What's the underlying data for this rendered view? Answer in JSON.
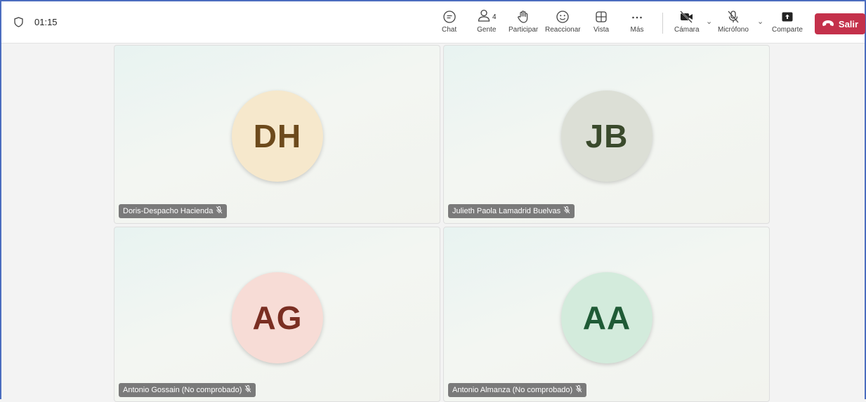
{
  "timer": "01:15",
  "toolbar": {
    "chat": "Chat",
    "people": "Gente",
    "people_count": "4",
    "raise": "Participar",
    "react": "Reaccionar",
    "view": "Vista",
    "more": "Más",
    "camera": "Cámara",
    "mic": "Micrófono",
    "share": "Comparte",
    "leave": "Salir"
  },
  "participants": [
    {
      "initials": "DH",
      "name": "Doris-Despacho Hacienda",
      "avatar_bg": "#f6e8cc",
      "avatar_fg": "#6d4a1c"
    },
    {
      "initials": "JB",
      "name": "Julieth Paola Lamadrid Buelvas",
      "avatar_bg": "#dcdfd6",
      "avatar_fg": "#3a4a2c"
    },
    {
      "initials": "AG",
      "name": "Antonio Gossain (No comprobado)",
      "avatar_bg": "#f7dcd6",
      "avatar_fg": "#7a2e22"
    },
    {
      "initials": "AA",
      "name": "Antonio Almanza (No comprobado)",
      "avatar_bg": "#d3ebdc",
      "avatar_fg": "#1f5b36"
    }
  ],
  "colors": {
    "leave_button": "#c4314b",
    "window_border": "#4b6dbf"
  }
}
